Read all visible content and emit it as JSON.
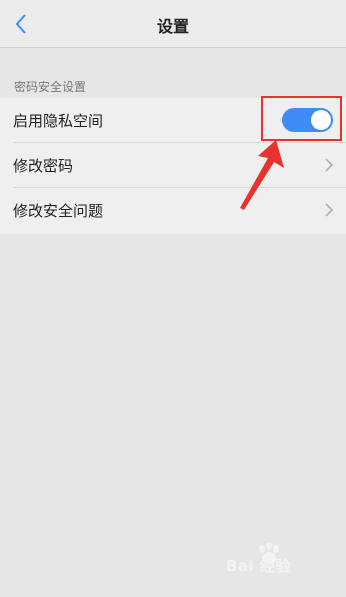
{
  "header": {
    "title": "设置",
    "back_icon": "chevron-left-icon"
  },
  "section": {
    "label": "密码安全设置"
  },
  "rows": [
    {
      "label": "启用隐私空间",
      "control": "toggle",
      "toggle_on": true
    },
    {
      "label": "修改密码",
      "control": "chevron"
    },
    {
      "label": "修改安全问题",
      "control": "chevron"
    }
  ],
  "colors": {
    "accent": "#3d8cf5",
    "annotation": "#e8322d"
  },
  "watermark": {
    "text": "Bai 经验"
  }
}
